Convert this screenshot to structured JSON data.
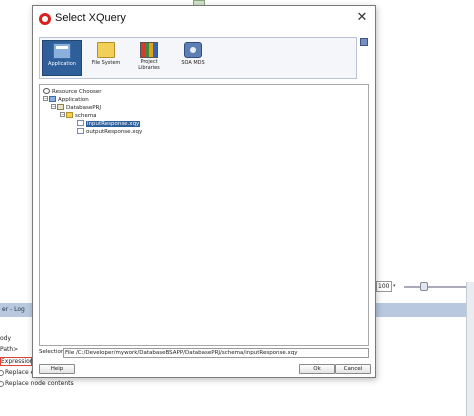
{
  "dialog": {
    "title": "Select XQuery",
    "toolbar": [
      {
        "id": "application",
        "label": "Application",
        "selected": true
      },
      {
        "id": "file-system",
        "label": "File System",
        "selected": false
      },
      {
        "id": "project-libraries",
        "label_line1": "Project",
        "label_line2": "Libraries",
        "selected": false
      },
      {
        "id": "soa-mds",
        "label": "SOA MDS",
        "selected": false
      }
    ],
    "tree": {
      "root": "Resource Chooser",
      "items": [
        {
          "label": "Application",
          "icon": "application-icon"
        },
        {
          "label": "DatabasePRJ",
          "icon": "project-icon"
        },
        {
          "label": "schema",
          "icon": "folder-icon"
        },
        {
          "label": "inputResponse.xqy",
          "icon": "xquery-file-icon",
          "selected": true
        },
        {
          "label": "outputResponse.xqy",
          "icon": "xquery-file-icon",
          "selected": false
        }
      ]
    },
    "selection_label": "Selection:",
    "selection_value": "File /C:/Developer/mywork/DatabaseBSAPP/DatabasePRJ/schema/inputResponse.xqy",
    "buttons": {
      "help": "Help",
      "ok": "Ok",
      "cancel": "Cancel"
    }
  },
  "background": {
    "zoom_value": "100",
    "log_tab": "er - Log",
    "text_body": "ody",
    "text_xpath": "Path>",
    "text_expression": "Expression",
    "text_replace1": "Replace en",
    "text_replace2": "Replace node contents"
  },
  "colors": {
    "selection_blue": "#2e5f9a",
    "log_bar": "#b8c9df",
    "oracle_red": "#d8211e"
  }
}
